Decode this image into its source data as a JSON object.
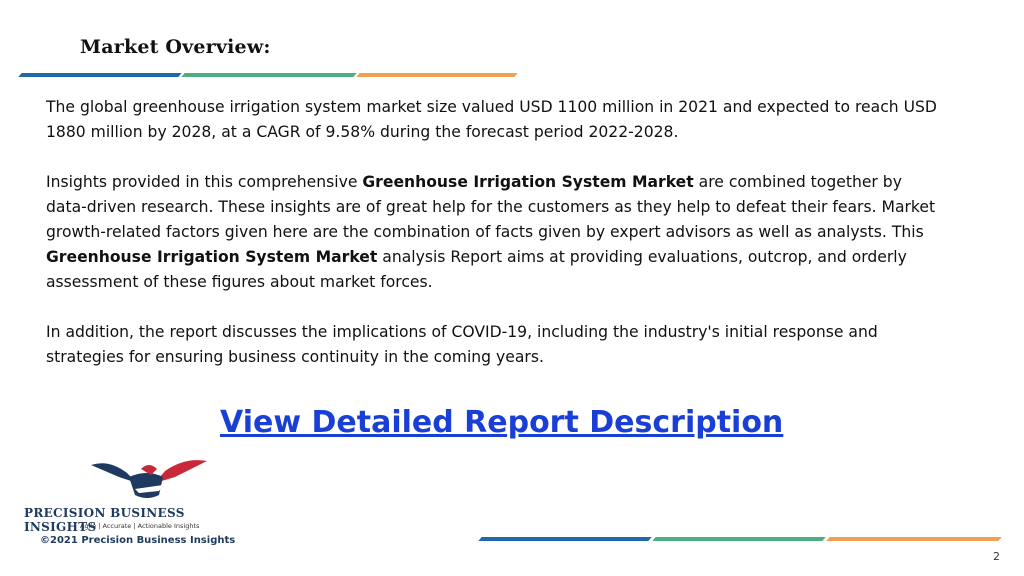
{
  "header": {
    "title": "Market Overview:"
  },
  "colors": {
    "blue": "#1f6aa6",
    "green": "#4caf82",
    "orange": "#f0a050",
    "link": "#1a3fd4",
    "brand": "#1f3a5f"
  },
  "paragraph1": "The global greenhouse irrigation system market size valued USD 1100 million in 2021 and expected to reach USD 1880 million by 2028, at a CAGR of 9.58% during the forecast period 2022-2028.",
  "paragraph2": {
    "part1": "Insights provided in this comprehensive ",
    "bold1": "Greenhouse Irrigation System Market",
    "part2": " are combined together by data-driven research. These insights are of great help for the customers as they help to defeat their fears. Market growth-related factors given here are the combination of facts given by expert advisors as well as analysts. This ",
    "bold2": "Greenhouse Irrigation System Market",
    "part3": " analysis Report aims at providing evaluations, outcrop, and orderly assessment of these figures about market forces."
  },
  "paragraph3": "In addition, the report discusses the implications of COVID-19, including the industry's initial response and strategies for ensuring business continuity in the coming years.",
  "cta": {
    "label": "View Detailed Report Description"
  },
  "footer": {
    "logo_name": "PRECISION BUSINESS INSIGHTS",
    "logo_tagline": "Agile | Accurate | Actionable Insights",
    "copyright": "©2021 Precision Business Insights",
    "page_number": "2",
    "logo_icon": "eagle-handshake-icon"
  }
}
